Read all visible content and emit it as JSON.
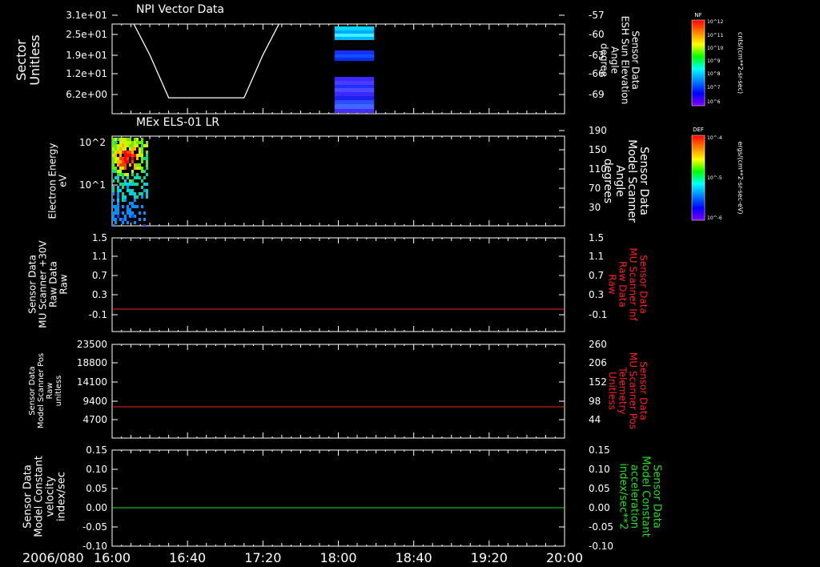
{
  "time_axis": {
    "date_label": "2006/080",
    "ticks": [
      "16:00",
      "16:40",
      "17:20",
      "18:00",
      "18:40",
      "19:20",
      "20:00"
    ]
  },
  "chart_data": [
    {
      "type": "heatmap",
      "title": "NPI Vector Data",
      "ylabel_left": [
        "Sector",
        "Unitless"
      ],
      "ylabel_right": [
        "Sensor Data",
        "ESH Sun Elevation",
        "Angle",
        "degree"
      ],
      "y_ticks_left": [
        "3.1e+01",
        "2.5e+01",
        "1.9e+01",
        "1.2e+01",
        "6.2e+00"
      ],
      "y_ticks_right": [
        "-57",
        "-60",
        "-63",
        "-66",
        "-69"
      ],
      "overlay_line": {
        "name": "ESH Sun Elevation",
        "color": "#ffffff",
        "x": [
          "16:00",
          "16:10",
          "16:20",
          "16:30",
          "17:10",
          "17:20",
          "17:30",
          "17:40",
          "20:00"
        ],
        "y": [
          -57.2,
          -57.5,
          -63.0,
          -69.5,
          -69.5,
          -63.0,
          -57.5,
          -57.2,
          -57.2
        ]
      },
      "heat_blocks_time": [
        "17:58",
        "18:19"
      ],
      "colorbar": {
        "label": "NF",
        "unit": "cnts/(cm**2-sr-sec)",
        "ticks": [
          "10^12",
          "10^11",
          "10^10",
          "10^9",
          "10^8",
          "10^7",
          "10^6"
        ]
      }
    },
    {
      "type": "heatmap",
      "title": "MEx ELS-01 LR",
      "ylabel_left": [
        "Electron Energy",
        "eV"
      ],
      "ylabel_right": [
        "Sensor Data",
        "Model Scanner",
        "Angle",
        "degrees"
      ],
      "y_ticks_left": [
        "10^2",
        "10^1"
      ],
      "y_ticks_right": [
        "190",
        "150",
        "110",
        "70",
        "30"
      ],
      "x_range": [
        "16:00",
        "16:19"
      ],
      "colorbar": {
        "label": "DEF",
        "unit": "ergs/(cm**2-sr-sec-eV)",
        "ticks": [
          "10^-4",
          "10^-5",
          "10^-6"
        ]
      }
    },
    {
      "type": "line",
      "ylabel_left": [
        "Sensor Data",
        "MU Scanner +30V",
        "Raw Data",
        "Raw"
      ],
      "ylabel_right": [
        "Sensor Data",
        "MU Scanner Inf",
        "Raw Data",
        "Raw"
      ],
      "y_ticks_left": [
        "1.5",
        "1.1",
        "0.7",
        "0.3",
        "-0.1"
      ],
      "y_ticks_right": [
        "1.5",
        "1.1",
        "0.7",
        "0.3",
        "-0.1"
      ],
      "ylim": [
        -0.3,
        1.5
      ],
      "series": [
        {
          "color": "#ff2020",
          "x": [
            "16:00",
            "20:00"
          ],
          "y": [
            -0.05,
            -0.05
          ]
        }
      ]
    },
    {
      "type": "line",
      "ylabel_left": [
        "Sensor Data",
        "Model Scanner Pos",
        "Raw",
        "unitless"
      ],
      "ylabel_right": [
        "Sensor Data",
        "MU Scanner Pos",
        "Telemetry",
        "Unitless"
      ],
      "y_ticks_left": [
        "23500",
        "18800",
        "14100",
        "9400",
        "4700"
      ],
      "y_ticks_right": [
        "260",
        "206",
        "152",
        "98",
        "44"
      ],
      "ylim": [
        0,
        23500
      ],
      "series": [
        {
          "color": "#ff2020",
          "x": [
            "16:00",
            "20:00"
          ],
          "y": [
            8400,
            8400
          ]
        }
      ]
    },
    {
      "type": "line",
      "ylabel_left": [
        "Sensor Data",
        "Model Constant",
        "velocity",
        "index/sec"
      ],
      "ylabel_right": [
        "Sensor Data",
        "Model Constant",
        "acceleration",
        "index/sec**2"
      ],
      "y_ticks_left": [
        "0.15",
        "0.10",
        "0.05",
        "0.00",
        "-0.05",
        "-0.10"
      ],
      "y_ticks_right": [
        "0.15",
        "0.10",
        "0.05",
        "0.00",
        "-0.05",
        "-0.10"
      ],
      "ylim": [
        -0.1,
        0.15
      ],
      "series": [
        {
          "color": "#20e020",
          "x": [
            "16:00",
            "20:00"
          ],
          "y": [
            0.0,
            0.0
          ]
        }
      ]
    }
  ],
  "colors": {
    "background": "#000000",
    "axis": "#ffffff",
    "red_label": "#ff2020",
    "green_label": "#20e020"
  }
}
